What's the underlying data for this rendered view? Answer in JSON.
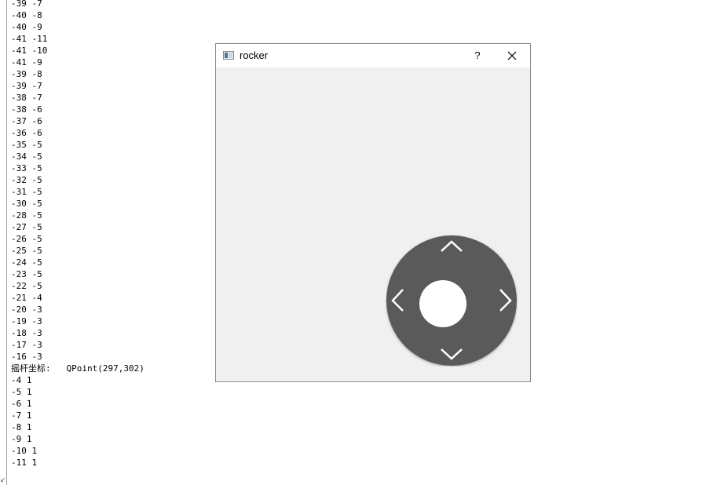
{
  "console": {
    "lines": [
      "-39 -7",
      "-40 -8",
      "-40 -9",
      "-41 -11",
      "-41 -10",
      "-41 -9",
      "-39 -8",
      "-39 -7",
      "-38 -7",
      "-38 -6",
      "-37 -6",
      "-36 -6",
      "-35 -5",
      "-34 -5",
      "-33 -5",
      "-32 -5",
      "-31 -5",
      "-30 -5",
      "-28 -5",
      "-27 -5",
      "-26 -5",
      "-25 -5",
      "-24 -5",
      "-23 -5",
      "-22 -5",
      "-21 -4",
      "-20 -3",
      "-19 -3",
      "-18 -3",
      "-17 -3",
      "-16 -3",
      "摇杆坐标:   QPoint(297,302)",
      "-4 1",
      "-5 1",
      "-6 1",
      "-7 1",
      "-8 1",
      "-9 1",
      "-10 1",
      "-11 1"
    ],
    "corner_glyph": "↙"
  },
  "dialog": {
    "title": "rocker",
    "help_label": "?",
    "icon": "app-window-icon",
    "close_icon": "close-icon"
  },
  "rocker": {
    "base_color": "#5a5a5a",
    "knob_color": "#ffffff",
    "arrow_color": "#ffffff",
    "icons": [
      "chevron-up-icon",
      "chevron-down-icon",
      "chevron-left-icon",
      "chevron-right-icon"
    ]
  }
}
